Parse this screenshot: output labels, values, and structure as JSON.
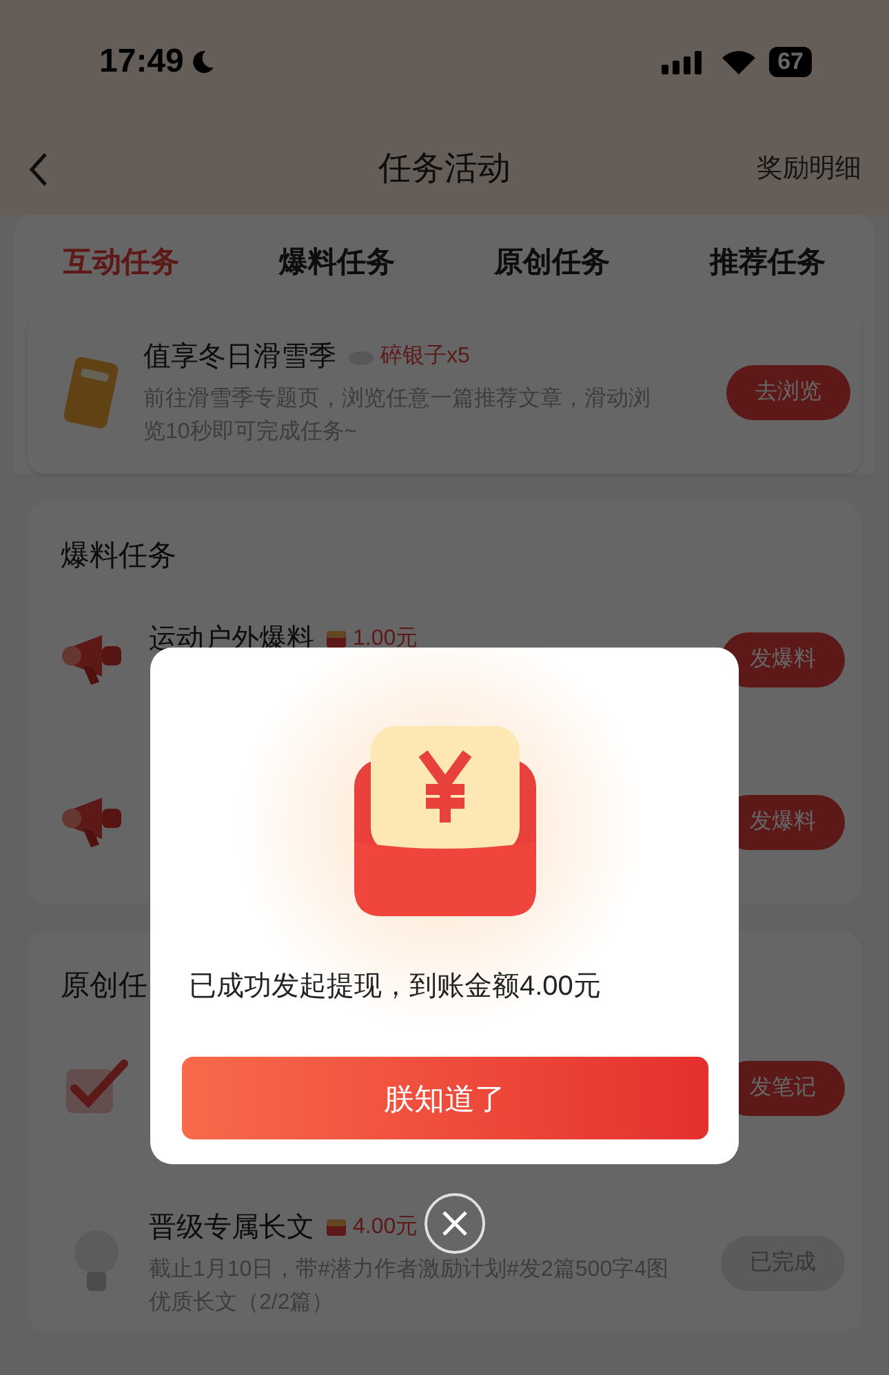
{
  "status_bar": {
    "time": "17:49",
    "battery": "67"
  },
  "header": {
    "title": "任务活动",
    "action": "奖励明细"
  },
  "tabs": [
    {
      "label": "互动任务",
      "selected": true
    },
    {
      "label": "爆料任务",
      "selected": false
    },
    {
      "label": "原创任务",
      "selected": false
    },
    {
      "label": "推荐任务",
      "selected": false
    }
  ],
  "featured_task": {
    "kind": "ticket",
    "title": "值享冬日滑雪季",
    "reward": {
      "kind": "silver",
      "text": "碎银子x5"
    },
    "description": "前往滑雪季专题页，浏览任意一篇推荐文章，滑动浏览10秒即可完成任务~",
    "button": "去浏览",
    "done": false
  },
  "sections": [
    {
      "title": "爆料任务",
      "tasks": [
        {
          "kind": "megaphone",
          "title": "运动户外爆料",
          "reward": {
            "kind": "cash",
            "text": "1.00元"
          },
          "button": "发爆料",
          "done": false
        },
        {
          "kind": "megaphone",
          "button": "发爆料",
          "done": false
        }
      ]
    },
    {
      "title": "原创任",
      "tasks": [
        {
          "kind": "check",
          "button": "发笔记",
          "done": false
        },
        {
          "kind": "bulb",
          "title": "晋级专属长文",
          "reward": {
            "kind": "cash",
            "text": "4.00元"
          },
          "description": "截止1月10日，带#潜力作者激励计划#发2篇500字4图优质长文（2/2篇）",
          "button": "已完成",
          "done": true
        }
      ]
    }
  ],
  "dialog": {
    "message": "已成功发起提现，到账金额4.00元",
    "button": "朕知道了"
  }
}
